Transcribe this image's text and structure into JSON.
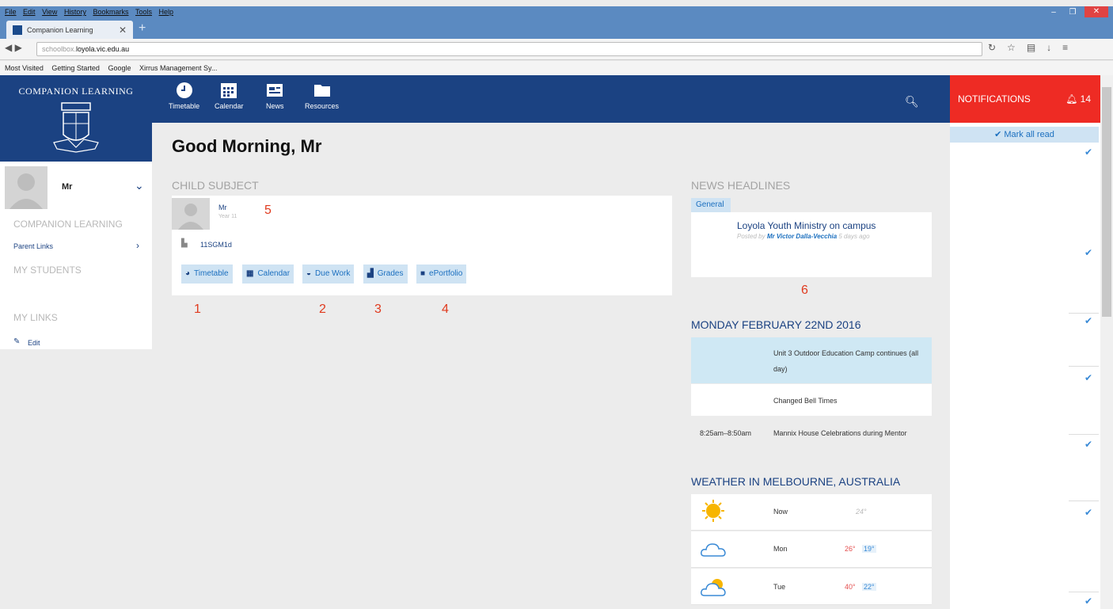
{
  "browser": {
    "menu": [
      "File",
      "Edit",
      "View",
      "History",
      "Bookmarks",
      "Tools",
      "Help"
    ],
    "tab_title": "Companion Learning",
    "url_host_prefix": "schoolbox.",
    "url_host": "loyola.vic.edu.au",
    "bookmarks": [
      "Most Visited",
      "Getting Started",
      "Google",
      "Xirrus Management Sy..."
    ]
  },
  "app": {
    "brand": "COMPANION LEARNING",
    "nav": [
      {
        "label": "Timetable",
        "icon": "clock-icon"
      },
      {
        "label": "Calendar",
        "icon": "calendar-icon"
      },
      {
        "label": "News",
        "icon": "news-icon"
      },
      {
        "label": "Resources",
        "icon": "folder-icon"
      }
    ]
  },
  "notifications": {
    "title": "NOTIFICATIONS",
    "count": "14",
    "mark_all": "Mark all read"
  },
  "sidebar": {
    "profile_name": "Mr",
    "section_companion": "COMPANION LEARNING",
    "parent_links": "Parent Links",
    "section_students": "MY STUDENTS",
    "section_links": "MY LINKS",
    "edit": "Edit"
  },
  "main": {
    "greeting": "Good Morning, Mr",
    "child_heading": "CHILD SUBJECT",
    "child": {
      "name": "Mr",
      "year": "Year 11",
      "class": "11SGM1d",
      "buttons": [
        "Timetable",
        "Calendar",
        "Due Work",
        "Grades",
        "ePortfolio"
      ]
    },
    "annotations": [
      "1",
      "2",
      "3",
      "4",
      "5",
      "6"
    ]
  },
  "news": {
    "heading": "NEWS HEADLINES",
    "tab": "General",
    "title": "Loyola Youth Ministry on campus",
    "posted_by_prefix": "Posted by",
    "author": "Mr Victor Dalla-Vecchia",
    "age": "5 days ago"
  },
  "calendar": {
    "heading": "MONDAY FEBRUARY 22ND 2016",
    "events": [
      {
        "time": "",
        "title": "Unit 3 Outdoor Education Camp continues (all day)"
      },
      {
        "time": "",
        "title": "Changed Bell Times"
      },
      {
        "time": "8:25am–8:50am",
        "title": "Mannix House Celebrations during Mentor"
      }
    ]
  },
  "weather": {
    "heading": "WEATHER IN MELBOURNE, AUSTRALIA",
    "rows": [
      {
        "day": "Now",
        "temp": "24°",
        "icon": "sun-icon"
      },
      {
        "day": "Mon",
        "hi": "26°",
        "lo": "19°",
        "icon": "cloud-icon"
      },
      {
        "day": "Tue",
        "hi": "40°",
        "lo": "22°",
        "icon": "partly-sunny-icon"
      }
    ]
  }
}
